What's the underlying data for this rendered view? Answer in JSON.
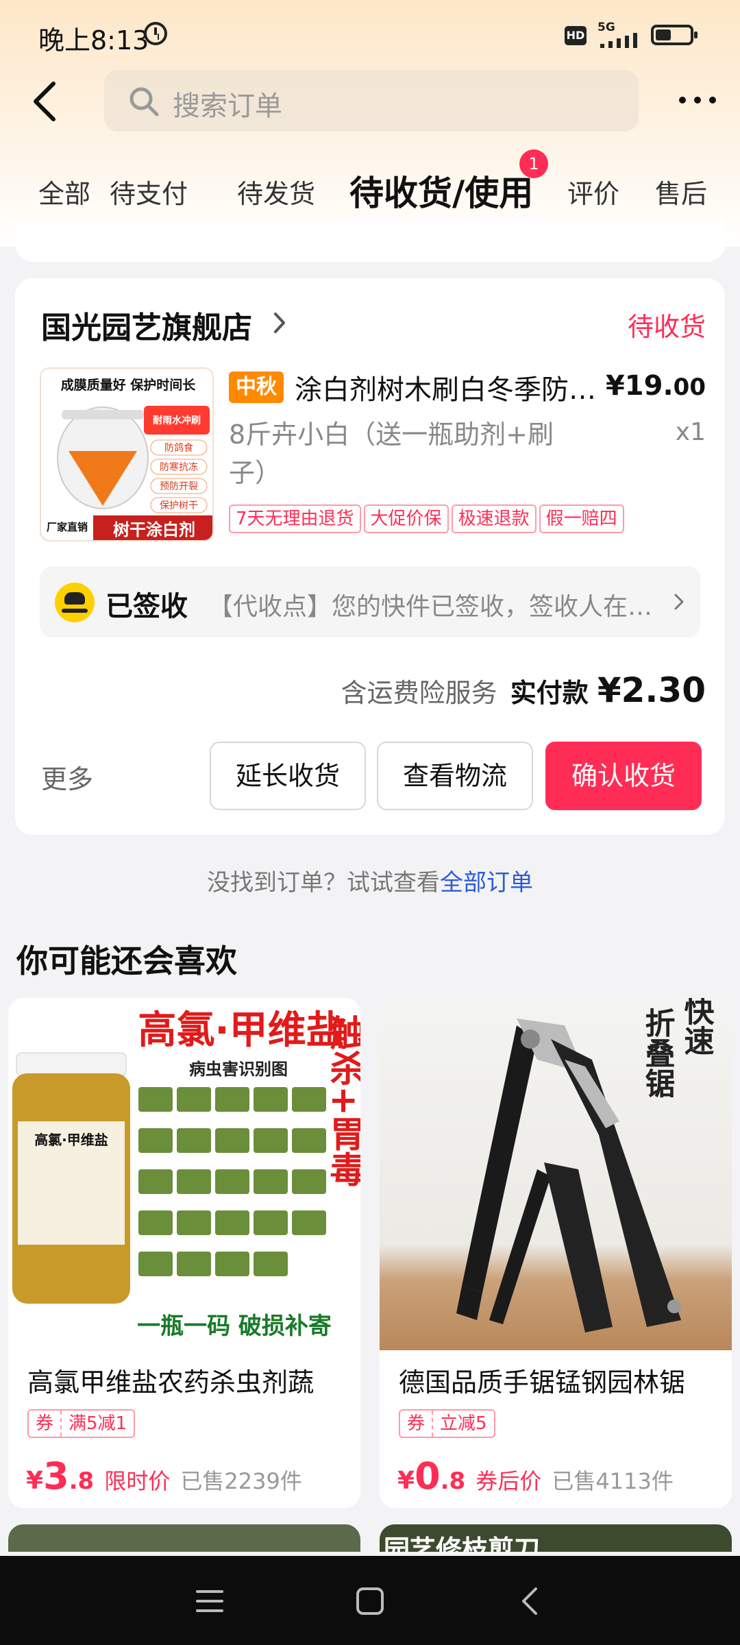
{
  "status_bar": {
    "time": "晚上8:13",
    "hd": "HD",
    "network": "5G"
  },
  "header": {
    "search_placeholder": "搜索订单"
  },
  "tabs": [
    {
      "label": "全部"
    },
    {
      "label": "待支付"
    },
    {
      "label": "待发货"
    },
    {
      "label": "待收货/使用",
      "active": true,
      "badge": "1"
    },
    {
      "label": "评价"
    },
    {
      "label": "售后"
    }
  ],
  "order": {
    "shop_name": "国光园艺旗舰店",
    "status": "待收货",
    "product": {
      "tag": "中秋",
      "title": "涂白剂树木刷白冬季防冻防虫",
      "price_main": "¥19.",
      "price_cents": "00",
      "variant": "8斤卉小白（送一瓶助剂+刷子）",
      "quantity": "x1",
      "image_text": {
        "banner": "成膜质量好 保护时间长",
        "stamp": "耐雨水冲刷",
        "features": [
          "防鸽食",
          "防寒抗冻",
          "预防开裂",
          "保护树干"
        ],
        "corner": "厂家直销",
        "bottom": "树干涂白剂"
      }
    },
    "service_tags": [
      "7天无理由退货",
      "大促价保",
      "极速退款",
      "假一赔四"
    ],
    "logistics": {
      "status": "已签收",
      "text": "【代收点】您的快件已签收，签收人在【菜鸟驿站】"
    },
    "payment": {
      "insurance": "含运费险服务",
      "label": "实付款",
      "amount": "¥2.30"
    },
    "more": "更多",
    "buttons": {
      "extend": "延长收货",
      "logistics": "查看物流",
      "confirm": "确认收货"
    }
  },
  "not_found": {
    "text": "没找到订单？试试查看",
    "link": "全部订单"
  },
  "recommend": {
    "title": "你可能还会喜欢",
    "items": [
      {
        "title": "高氯甲维盐农药杀虫剂蔬",
        "coupon_a": "券",
        "coupon_b": "满5减1",
        "yen": "¥",
        "price_int": "3",
        "price_dec": ".8",
        "price_label": "限时价",
        "sold": "已售2239件",
        "image_text": {
          "headline": "高氯·甲维盐",
          "sub": "病虫害识别图",
          "side": "触杀+胃毒",
          "bottom": "一瓶一码 破损补寄",
          "bottle": "高氯·甲维盐"
        }
      },
      {
        "title": "德国品质手锯锰钢园林锯",
        "coupon_a": "券",
        "coupon_b": "立减5",
        "yen": "¥",
        "price_int": "0",
        "price_dec": ".8",
        "price_label": "券后价",
        "sold": "已售4113件",
        "image_text": {
          "side_a": "折叠锯",
          "side_b": "快速"
        }
      }
    ],
    "peek_text": "园艺修枝剪刀"
  }
}
